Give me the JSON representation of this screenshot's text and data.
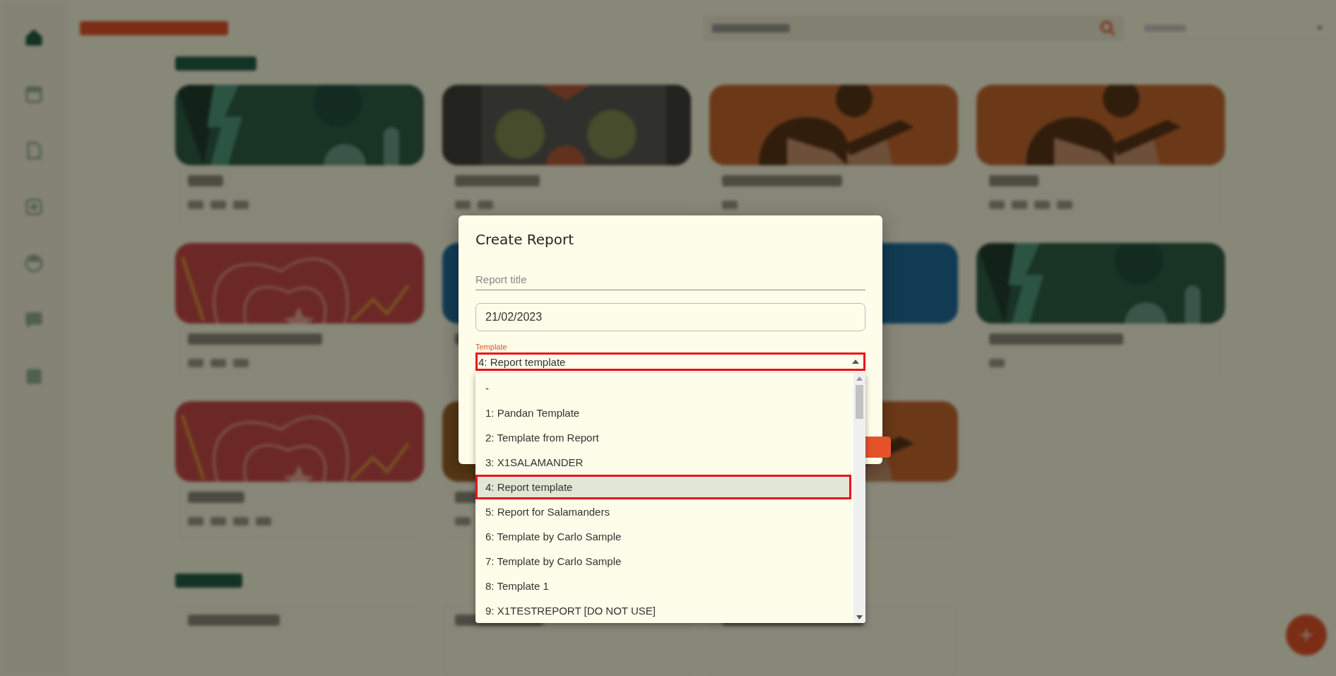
{
  "sidebar": {
    "items": [
      {
        "selected": true
      },
      {
        "selected": false
      },
      {
        "selected": false
      },
      {
        "selected": false
      },
      {
        "selected": false
      },
      {
        "selected": false
      },
      {
        "selected": false
      }
    ]
  },
  "dialog": {
    "title": "Create Report",
    "report_title": {
      "placeholder": "Report title"
    },
    "date": {
      "value": "21/02/2023"
    },
    "template": {
      "label": "Template",
      "value": "4: Report template",
      "expanded": true,
      "options": [
        {
          "label": "-",
          "selected": false
        },
        {
          "label": "1: Pandan Template",
          "selected": false
        },
        {
          "label": "2: Template from Report",
          "selected": false
        },
        {
          "label": "3: X1SALAMANDER",
          "selected": false
        },
        {
          "label": "4: Report template",
          "selected": true
        },
        {
          "label": "5: Report for Salamanders",
          "selected": false
        },
        {
          "label": "6: Template by Carlo Sample",
          "selected": false
        },
        {
          "label": "7: Template by Carlo Sample",
          "selected": false
        },
        {
          "label": "8: Template 1",
          "selected": false
        },
        {
          "label": "9: X1TESTREPORT [DO NOT USE]",
          "selected": false
        }
      ]
    }
  }
}
